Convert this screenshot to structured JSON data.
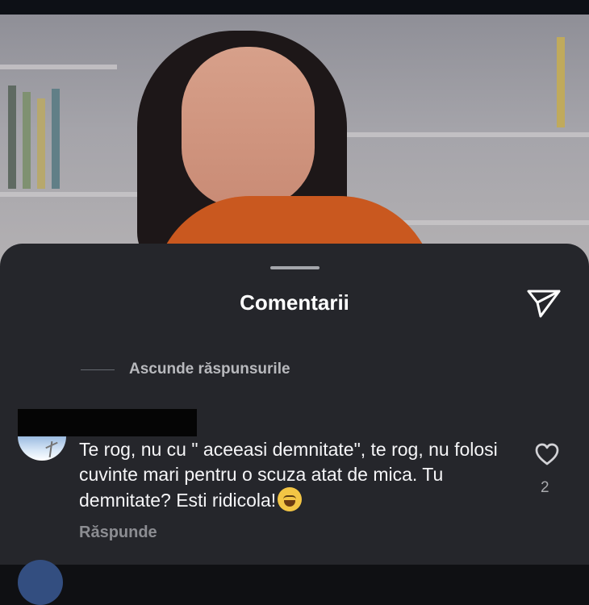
{
  "sheet": {
    "title": "Comentarii",
    "send_icon": "send-icon",
    "replies_toggle": "Ascunde răspunsurile"
  },
  "comment": {
    "text_before_emoji": "Te rog, nu cu \" aceeasi demnitate\", te rog, nu folosi cuvinte mari pentru o scuza atat de mica. Tu demnitate? Esti ridicola!",
    "emoji": "laughing-with-tears-icon",
    "reply_label": "Răspunde",
    "like_icon": "heart-icon",
    "like_count": "2"
  },
  "colors": {
    "sheet_bg": "#25262b",
    "text": "#f5f5f7",
    "muted_text": "#8c8d92"
  }
}
